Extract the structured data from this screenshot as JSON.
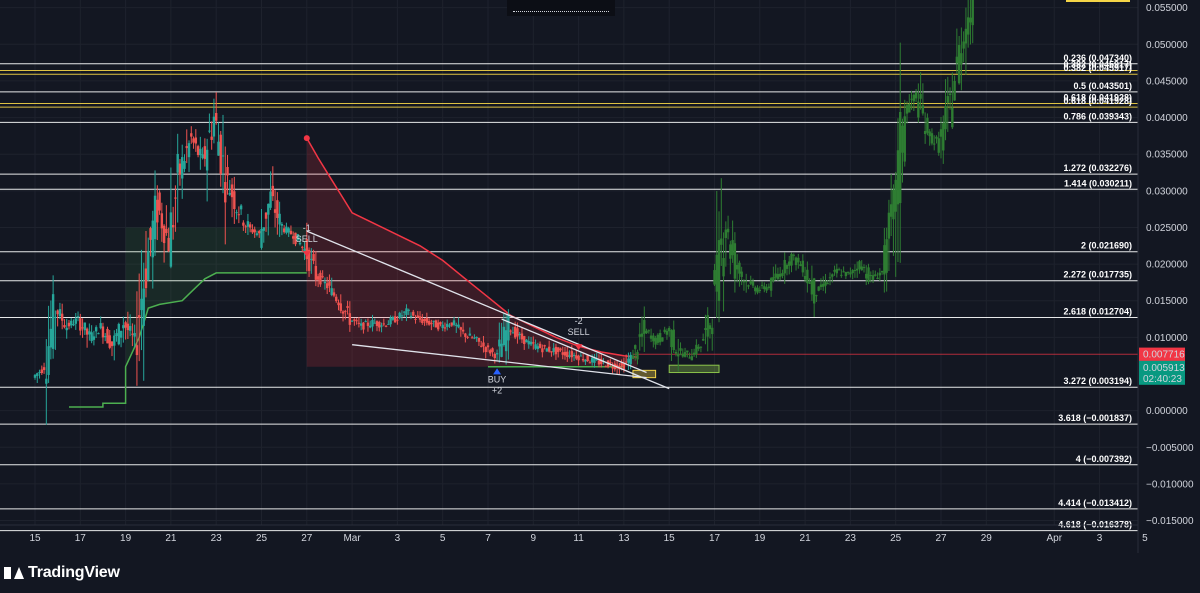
{
  "brand": {
    "name": "TradingView"
  },
  "chart_data": {
    "type": "candlestick",
    "ylim": [
      -0.0152,
      0.0555
    ],
    "y_ticks": [
      {
        "v": 0.055,
        "label": "0.055000"
      },
      {
        "v": 0.05,
        "label": "0.050000"
      },
      {
        "v": 0.045,
        "label": "0.045000"
      },
      {
        "v": 0.04,
        "label": "0.040000"
      },
      {
        "v": 0.035,
        "label": "0.035000"
      },
      {
        "v": 0.03,
        "label": "0.030000"
      },
      {
        "v": 0.025,
        "label": "0.025000"
      },
      {
        "v": 0.02,
        "label": "0.020000"
      },
      {
        "v": 0.015,
        "label": "0.015000"
      },
      {
        "v": 0.01,
        "label": "0.010000"
      },
      {
        "v": 0.0,
        "label": "0.000000"
      },
      {
        "v": -0.005,
        "label": "−0.005000"
      },
      {
        "v": -0.01,
        "label": "−0.010000"
      },
      {
        "v": -0.015,
        "label": "−0.015000"
      }
    ],
    "x_range": [
      0,
      48.5
    ],
    "x_ticks": [
      {
        "d": 0,
        "label": "15"
      },
      {
        "d": 2,
        "label": "17"
      },
      {
        "d": 4,
        "label": "19"
      },
      {
        "d": 6,
        "label": "21"
      },
      {
        "d": 8,
        "label": "23"
      },
      {
        "d": 10,
        "label": "25"
      },
      {
        "d": 12,
        "label": "27"
      },
      {
        "d": 14,
        "label": "Mar"
      },
      {
        "d": 16,
        "label": "3"
      },
      {
        "d": 18,
        "label": "5"
      },
      {
        "d": 20,
        "label": "7"
      },
      {
        "d": 22,
        "label": "9"
      },
      {
        "d": 24,
        "label": "11"
      },
      {
        "d": 26,
        "label": "13"
      },
      {
        "d": 28,
        "label": "15"
      },
      {
        "d": 30,
        "label": "17"
      },
      {
        "d": 32,
        "label": "19"
      },
      {
        "d": 34,
        "label": "21"
      },
      {
        "d": 36,
        "label": "23"
      },
      {
        "d": 38,
        "label": "25"
      },
      {
        "d": 40,
        "label": "27"
      },
      {
        "d": 42,
        "label": "29"
      },
      {
        "d": 45,
        "label": "Apr"
      },
      {
        "d": 47,
        "label": "3"
      },
      {
        "d": 49,
        "label": "5"
      }
    ],
    "fib_levels": [
      {
        "label": "0.236 (0.047340)",
        "v": 0.04734,
        "color": "#ffffff"
      },
      {
        "label": "0.382 (0.045917)",
        "v": 0.046417,
        "color": "#f5d547"
      },
      {
        "label": "0.382 (0.045917)",
        "v": 0.045917,
        "color": "#f5d547"
      },
      {
        "label": "0.5 (0.043501)",
        "v": 0.043501,
        "color": "#ffffff"
      },
      {
        "label": "0.618 (0.041928)",
        "v": 0.041928,
        "color": "#f5d547"
      },
      {
        "label": "0.618 (0.041928)",
        "v": 0.041428,
        "color": "#f5d547"
      },
      {
        "label": "0.786 (0.039343)",
        "v": 0.039343,
        "color": "#ffffff"
      },
      {
        "label": "1.272 (0.032276)",
        "v": 0.032276,
        "color": "#ffffff"
      },
      {
        "label": "1.414 (0.030211)",
        "v": 0.030211,
        "color": "#ffffff"
      },
      {
        "label": "2 (0.021690)",
        "v": 0.02169,
        "color": "#ffffff"
      },
      {
        "label": "2.272 (0.017735)",
        "v": 0.017735,
        "color": "#ffffff"
      },
      {
        "label": "2.618 (0.012704)",
        "v": 0.012704,
        "color": "#ffffff"
      },
      {
        "label": "3.272 (0.003194)",
        "v": 0.003194,
        "color": "#ffffff"
      },
      {
        "label": "3.618 (−0.001837)",
        "v": -0.001837,
        "color": "#ffffff"
      },
      {
        "label": "4 (−0.007392)",
        "v": -0.007392,
        "color": "#ffffff"
      },
      {
        "label": "4.414 (−0.013412)",
        "v": -0.013412,
        "color": "#ffffff"
      },
      {
        "label": "4.618 (−0.016378)",
        "v": -0.016378,
        "color": "#ffffff"
      }
    ],
    "price_tags": [
      {
        "label": "0.007716",
        "v": 0.007716,
        "color": "#f23645"
      },
      {
        "label": "0.006105",
        "v": 0.006105,
        "color": "#f23645"
      },
      {
        "label": "0.005913",
        "v": 0.005913,
        "color": "#089981"
      },
      {
        "label": "02:40:23",
        "v": 0.004413,
        "color": "#089981"
      }
    ],
    "signals": [
      {
        "d": 12.0,
        "v": 0.0245,
        "lines": [
          "-1",
          "SELL"
        ],
        "dir": "sell"
      },
      {
        "d": 20.4,
        "v": 0.00385,
        "lines": [
          "BUY",
          "+2"
        ],
        "dir": "buy"
      },
      {
        "d": 24.0,
        "v": 0.0118,
        "lines": [
          "-2",
          "SELL"
        ],
        "dir": "sell"
      }
    ],
    "candles_real": [
      [
        0.0,
        0.0045,
        0.006
      ],
      [
        0.5,
        0.006,
        0.014
      ],
      [
        1.0,
        0.014,
        0.0115
      ],
      [
        1.5,
        0.0115,
        0.0125
      ],
      [
        2.0,
        0.0125,
        0.01
      ],
      [
        2.5,
        0.01,
        0.0115
      ],
      [
        3.0,
        0.0115,
        0.009
      ],
      [
        3.5,
        0.009,
        0.012
      ],
      [
        4.0,
        0.012,
        0.0095
      ],
      [
        4.5,
        0.0095,
        0.02
      ],
      [
        5.0,
        0.02,
        0.028
      ],
      [
        5.5,
        0.028,
        0.023
      ],
      [
        6.0,
        0.023,
        0.033
      ],
      [
        6.5,
        0.033,
        0.037
      ],
      [
        7.0,
        0.037,
        0.034
      ],
      [
        7.5,
        0.034,
        0.04
      ],
      [
        8.0,
        0.04,
        0.032
      ],
      [
        8.5,
        0.032,
        0.028
      ],
      [
        9.0,
        0.028,
        0.025
      ],
      [
        9.5,
        0.025,
        0.024
      ],
      [
        10.0,
        0.024,
        0.029
      ],
      [
        10.5,
        0.029,
        0.025
      ],
      [
        11.0,
        0.025,
        0.024
      ],
      [
        11.5,
        0.024,
        0.022
      ],
      [
        12.0,
        0.022,
        0.0185
      ],
      [
        12.5,
        0.0185,
        0.017
      ],
      [
        13.0,
        0.017,
        0.015
      ],
      [
        13.5,
        0.015,
        0.0125
      ],
      [
        14.0,
        0.0125,
        0.0115
      ],
      [
        14.5,
        0.0115,
        0.012
      ],
      [
        15.0,
        0.012,
        0.0118
      ],
      [
        15.5,
        0.0118,
        0.0125
      ],
      [
        16.0,
        0.0125,
        0.0135
      ],
      [
        16.5,
        0.0135,
        0.0125
      ],
      [
        17.0,
        0.0125,
        0.012
      ],
      [
        17.5,
        0.012,
        0.0115
      ],
      [
        18.0,
        0.0115,
        0.012
      ],
      [
        18.5,
        0.012,
        0.0105
      ],
      [
        19.0,
        0.0105,
        0.0098
      ],
      [
        19.5,
        0.0098,
        0.0085
      ],
      [
        20.0,
        0.0085,
        0.0075
      ],
      [
        20.5,
        0.0075,
        0.0115
      ],
      [
        21.0,
        0.0115,
        0.01
      ],
      [
        21.5,
        0.01,
        0.009
      ],
      [
        22.0,
        0.009,
        0.0085
      ],
      [
        22.5,
        0.0085,
        0.0082
      ],
      [
        23.0,
        0.0082,
        0.0078
      ],
      [
        23.5,
        0.0078,
        0.0075
      ],
      [
        24.0,
        0.0075,
        0.007
      ],
      [
        24.5,
        0.007,
        0.0066
      ],
      [
        25.0,
        0.0066,
        0.0063
      ],
      [
        25.5,
        0.0063,
        0.006
      ],
      [
        26.0,
        0.006,
        0.0075
      ],
      [
        26.5,
        0.0075,
        0.011
      ],
      [
        27.0,
        0.011,
        0.0095
      ],
      [
        27.5,
        0.0095,
        0.011
      ],
      [
        28.0,
        0.011,
        0.008
      ],
      [
        28.5,
        0.008,
        0.0075
      ],
      [
        29.0,
        0.0075,
        0.009
      ],
      [
        29.5,
        0.009,
        0.013
      ],
      [
        30.0,
        0.013,
        0.026
      ],
      [
        30.5,
        0.026,
        0.02
      ],
      [
        31.0,
        0.02,
        0.0175
      ],
      [
        31.5,
        0.0175,
        0.0165
      ],
      [
        32.0,
        0.0165,
        0.017
      ],
      [
        32.5,
        0.017,
        0.019
      ],
      [
        33.0,
        0.019,
        0.021
      ],
      [
        33.5,
        0.021,
        0.0195
      ],
      [
        34.0,
        0.0195,
        0.016
      ],
      [
        34.5,
        0.016,
        0.0175
      ],
      [
        35.0,
        0.0175,
        0.019
      ],
      [
        35.5,
        0.019,
        0.0185
      ],
      [
        36.0,
        0.0185,
        0.02
      ],
      [
        36.5,
        0.02,
        0.018
      ],
      [
        37.0,
        0.018,
        0.019
      ],
      [
        37.5,
        0.019,
        0.027
      ],
      [
        38.0,
        0.027,
        0.041
      ],
      [
        38.5,
        0.041,
        0.043
      ],
      [
        39.0,
        0.043,
        0.038
      ],
      [
        39.5,
        0.038,
        0.036
      ],
      [
        40.0,
        0.036,
        0.042
      ],
      [
        40.5,
        0.042,
        0.05
      ],
      [
        41.0,
        0.05,
        0.056
      ]
    ],
    "red_trail": [
      [
        12.0,
        0.0372
      ],
      [
        12.5,
        0.0345
      ],
      [
        13.0,
        0.032
      ],
      [
        13.5,
        0.0295
      ],
      [
        14.0,
        0.027
      ],
      [
        15.0,
        0.0255
      ],
      [
        16.0,
        0.024
      ],
      [
        17.0,
        0.0225
      ],
      [
        18.0,
        0.0205
      ],
      [
        19.0,
        0.018
      ],
      [
        20.0,
        0.0155
      ],
      [
        21.0,
        0.013
      ],
      [
        22.0,
        0.0115
      ],
      [
        23.0,
        0.01
      ],
      [
        24.0,
        0.0088
      ],
      [
        25.0,
        0.008
      ],
      [
        26.0,
        0.0075
      ],
      [
        26.6,
        0.0073
      ]
    ],
    "green_trail": [
      [
        1.5,
        0.0005
      ],
      [
        3.0,
        0.0005
      ],
      [
        3.0,
        0.001
      ],
      [
        4.0,
        0.001
      ],
      [
        4.0,
        0.006
      ],
      [
        4.6,
        0.01
      ],
      [
        5.0,
        0.014
      ],
      [
        5.5,
        0.0145
      ],
      [
        6.5,
        0.015
      ],
      [
        7.0,
        0.0165
      ],
      [
        7.5,
        0.018
      ],
      [
        8.0,
        0.0188
      ],
      [
        10.0,
        0.0188
      ],
      [
        11.0,
        0.0188
      ],
      [
        12.0,
        0.0188
      ]
    ],
    "green_trail2": [
      [
        20.0,
        0.006
      ],
      [
        22.5,
        0.006
      ],
      [
        26.0,
        0.006
      ]
    ],
    "trendlines": [
      [
        [
          12.0,
          0.0245
        ],
        [
          27.0,
          0.0052
        ]
      ],
      [
        [
          14.0,
          0.009
        ],
        [
          27.0,
          0.0045
        ]
      ],
      [
        [
          20.6,
          0.0125
        ],
        [
          28.0,
          0.003
        ]
      ]
    ],
    "zones": [
      {
        "d0": 26.4,
        "d1": 27.4,
        "v0": 0.0045,
        "v1": 0.0055,
        "color": "#f5d547"
      },
      {
        "d0": 28.0,
        "d1": 30.2,
        "v0": 0.0052,
        "v1": 0.0062,
        "color": "#8bc34a"
      }
    ],
    "ref_line": {
      "v": 0.0077,
      "d0": 26.4,
      "d1": 48.5,
      "color": "#f23645"
    }
  }
}
